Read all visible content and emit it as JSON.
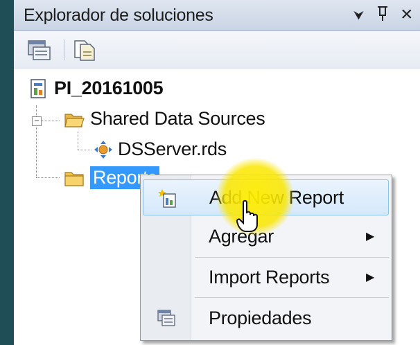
{
  "window": {
    "title": "Explorador de soluciones",
    "pin_glyph": "⮟",
    "dock_glyph": "⨅",
    "close_glyph": "×"
  },
  "toolbar": {
    "buttons": [
      {
        "icon": "properties-icon"
      },
      {
        "icon": "show-all-files-icon"
      }
    ]
  },
  "tree": {
    "project": {
      "label": "PI_20161005",
      "icon": "report-project-icon"
    },
    "shared_data_sources": {
      "label": "Shared Data Sources",
      "icon": "folder-open-icon",
      "expander": "−"
    },
    "datasource": {
      "label": "DSServer.rds",
      "icon": "datasource-icon"
    },
    "reports": {
      "label": "Reports",
      "icon": "folder-icon",
      "selected": true
    }
  },
  "context_menu": {
    "items": [
      {
        "label": "Add New Report",
        "icon": "new-report-icon",
        "highlighted": true,
        "submenu": false
      },
      {
        "label": "Agregar",
        "submenu": true,
        "arrow": "▶"
      },
      {
        "label": "Import Reports",
        "submenu": true,
        "arrow": "▶"
      },
      {
        "label": "Propiedades",
        "icon": "properties-icon",
        "submenu": false
      }
    ]
  },
  "colors": {
    "selection": "#3399ff",
    "cursor_highlight": "#ffee00",
    "menu_hover": "#d5e8fb"
  }
}
